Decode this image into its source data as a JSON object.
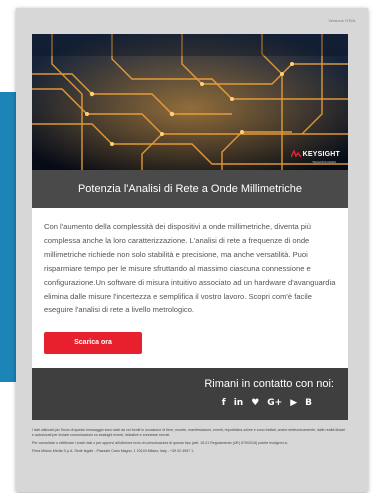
{
  "header": {
    "top_right": "Versione HTML"
  },
  "hero": {
    "brand": "KEYSIGHT",
    "brand_sub": "TECHNOLOGIES"
  },
  "title": "Potenzia l'Analisi di Rete a Onde Millimetriche",
  "body_text": "Con l'aumento della complessità dei dispositivi a onde millimetriche, diventa più complessa anche la loro caratterizzazione. L'analisi di rete a frequenze di onde millimetriche richiede non solo stabilità e precisione, ma anche versatilità. Puoi risparmiare tempo per le misure sfruttando al massimo ciascuna connessione e configurazione.Un software di misura intuitivo associato ad un hardware d'avanguardia elimina dalle misure l'incertezza e semplifica il vostro lavoro. Scopri com'è facile eseguire l'analisi di rete a livello metrologico.",
  "cta": {
    "label": "Scarica ora"
  },
  "footer": {
    "stay_in_touch": "Rimani in contatto con noi:",
    "socials": [
      {
        "icon": "facebook-icon",
        "glyph": "f"
      },
      {
        "icon": "linkedin-icon",
        "glyph": "in"
      },
      {
        "icon": "twitter-icon",
        "glyph": "♥"
      },
      {
        "icon": "googleplus-icon",
        "glyph": "G+"
      },
      {
        "icon": "youtube-icon",
        "glyph": "▶"
      },
      {
        "icon": "blog-icon",
        "glyph": "B"
      }
    ]
  },
  "legal": {
    "line1": "I dati utilizzati per l'invio di questo messaggio sono stati da voi forniti in occasione di fiere, mostre, manifestazioni, eventi, reportistica online e sono trattati, anche elettronicamente, dalle realtà titolari e autorizzati per inviare comunicazioni su analoghi eventi, iniziative e connesse servizi.",
    "line2": "Per consultare o rettificare i vostri dati o per opporvi all'ulteriore invio di comunicazioni di questo tipo (artt. 15-21 Regolamento (UE) 679/2016) potete rivolgervi a:",
    "line3": "Fiera Milano Media S.p.A. Sede legale - Piazzale Carlo Magno, 1 20149 Milano, Italy - +39 02 4997 1."
  },
  "colors": {
    "accent": "#e8202e",
    "title_band": "#4a4a4a",
    "footer_band": "#3f3f3f",
    "side_panel": "#1d84b8"
  }
}
